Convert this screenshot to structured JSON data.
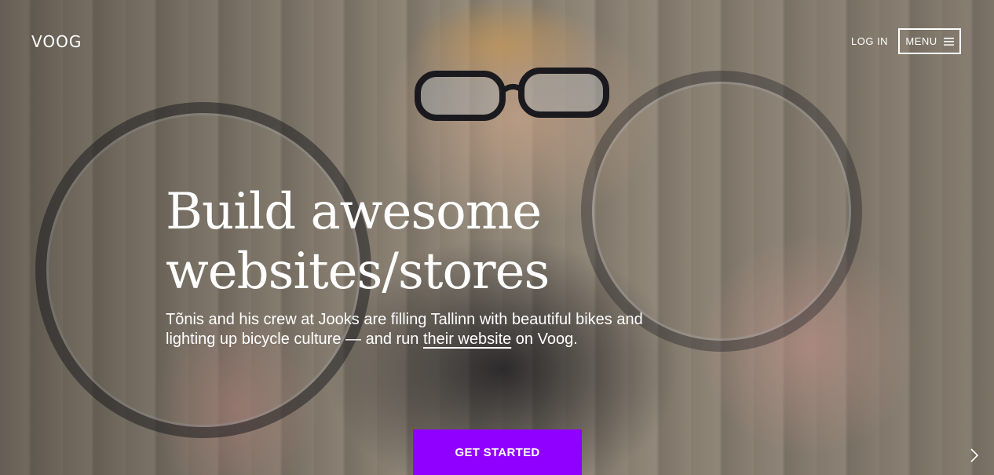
{
  "header": {
    "logo_text": "VOOG",
    "login_label": "LOG IN",
    "menu_label": "MENU"
  },
  "hero": {
    "headline_line1": "Build awesome",
    "headline_line2": "websites/stores",
    "subtext_before": "Tõnis and his crew at Jooks are filling Tallinn with beautiful bikes and lighting up bicycle culture — and run ",
    "subtext_link": "their website",
    "subtext_after": " on Voog.",
    "cta_label": "GET STARTED"
  },
  "icons": {
    "menu": "hamburger-icon",
    "next": "chevron-right-icon"
  },
  "colors": {
    "cta_background": "#8f00ff",
    "text": "#ffffff"
  }
}
